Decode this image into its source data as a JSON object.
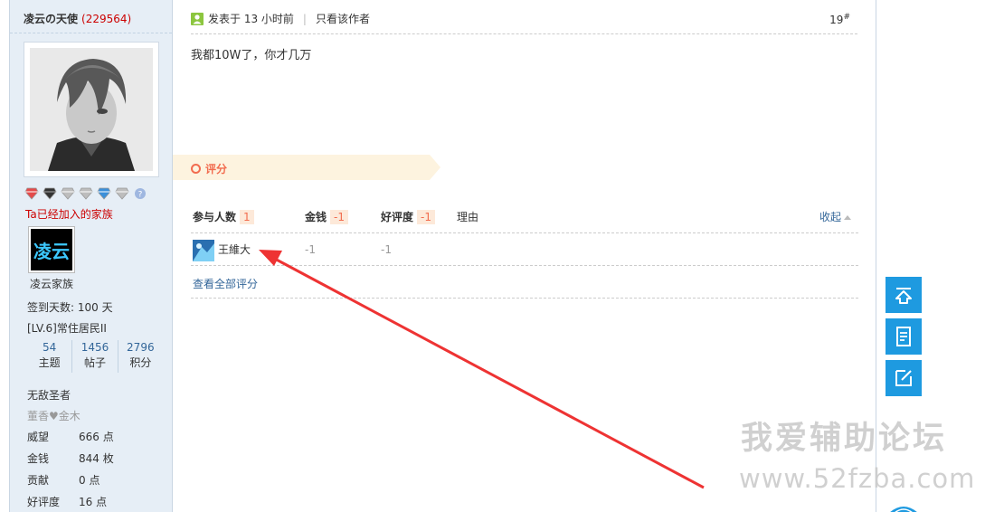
{
  "author": {
    "name": "凌云の天使",
    "uid": "(229564)",
    "family_label": "Ta已经加入的家族",
    "family_logo_text": "凌云",
    "family_name": "凌云家族",
    "checkin": "签到天数: 100 天",
    "level": "[LV.6]常住居民II",
    "stats": [
      {
        "value": "54",
        "label": "主题"
      },
      {
        "value": "1456",
        "label": "帖子"
      },
      {
        "value": "2796",
        "label": "积分"
      }
    ],
    "title": "无敌圣者",
    "title_sub": "董香♥金木",
    "details": [
      {
        "key": "威望",
        "value": "666 点"
      },
      {
        "key": "金钱",
        "value": "844 枚"
      },
      {
        "key": "贡献",
        "value": "0 点"
      },
      {
        "key": "好评度",
        "value": "16 点"
      }
    ],
    "medal_icons": [
      "red-medal-icon",
      "black-medal-icon",
      "silver-medal-icon",
      "silver-medal-icon",
      "blue-medal-icon",
      "silver-medal-icon",
      "question-medal-icon"
    ]
  },
  "post": {
    "posted_at": "发表于 13 小时前",
    "only_author": "只看该作者",
    "floor": "19",
    "floor_mark": "#",
    "content": "我都10W了，你才几万"
  },
  "rating": {
    "title": "评分",
    "headers": {
      "participants": "参与人数",
      "participants_count": "1",
      "money": "金钱",
      "money_total": "-1",
      "goodness": "好评度",
      "goodness_total": "-1",
      "reason": "理由"
    },
    "collapse": "收起",
    "rows": [
      {
        "name": "王維大",
        "money": "-1",
        "goodness": "-1",
        "reason": ""
      }
    ],
    "view_all": "查看全部评分"
  },
  "float_buttons": [
    "back-to-top-icon",
    "document-icon",
    "edit-icon"
  ],
  "watermark": {
    "line1": "我爱辅助论坛",
    "line2": "www.52fzba.com"
  },
  "colors": {
    "sidebar_bg": "#e6eef6",
    "accent_orange": "#f26c4f",
    "link_blue": "#336699",
    "float_blue": "#1e9ae0",
    "annotation_red": "#ee3333"
  }
}
